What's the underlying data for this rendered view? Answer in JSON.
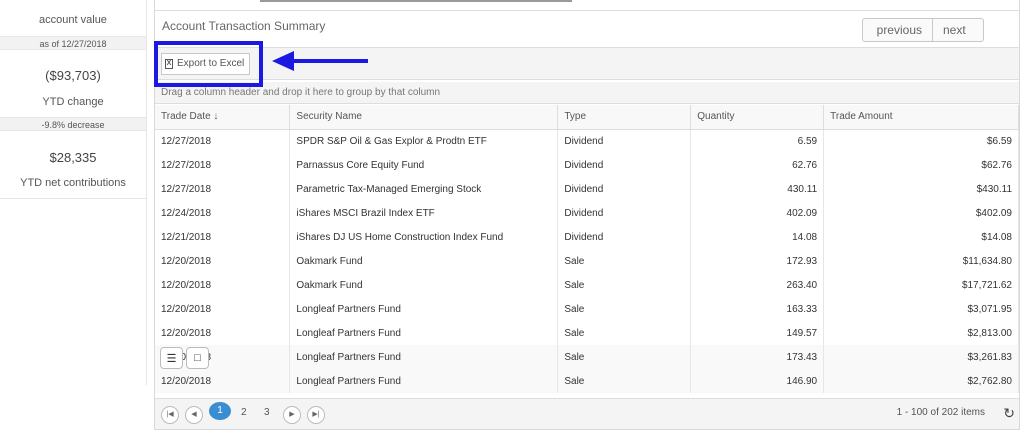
{
  "stats": [
    {
      "value": "",
      "label": "account value",
      "sub": "as of 12/27/2018"
    },
    {
      "value": "($93,703)",
      "label": "YTD change",
      "sub": "-9.8% decrease"
    },
    {
      "value": "$28,335",
      "label": "YTD net contributions",
      "sub": ""
    }
  ],
  "panel": {
    "title": "Account Transaction Summary",
    "previous_label": "previous",
    "next_label": "next",
    "export_label": "Export to Excel",
    "export_icon": "excel-file-icon",
    "group_hint": "Drag a column header and drop it here to group by that column"
  },
  "columns": [
    "Trade Date ↓",
    "Security Name",
    "Type",
    "Quantity",
    "Trade Amount"
  ],
  "rows": [
    [
      "12/27/2018",
      "SPDR S&P Oil & Gas Explor & Prodtn ETF",
      "Dividend",
      "6.59",
      "$6.59"
    ],
    [
      "12/27/2018",
      "Parnassus Core Equity Fund",
      "Dividend",
      "62.76",
      "$62.76"
    ],
    [
      "12/27/2018",
      "Parametric Tax-Managed Emerging Stock",
      "Dividend",
      "430.11",
      "$430.11"
    ],
    [
      "12/24/2018",
      "iShares MSCI Brazil Index ETF",
      "Dividend",
      "402.09",
      "$402.09"
    ],
    [
      "12/21/2018",
      "iShares DJ US Home Construction Index Fund",
      "Dividend",
      "14.08",
      "$14.08"
    ],
    [
      "12/20/2018",
      "Oakmark Fund",
      "Sale",
      "172.93",
      "$11,634.80"
    ],
    [
      "12/20/2018",
      "Oakmark Fund",
      "Sale",
      "263.40",
      "$17,721.62"
    ],
    [
      "12/20/2018",
      "Longleaf Partners Fund",
      "Sale",
      "163.33",
      "$3,071.95"
    ],
    [
      "12/20/2018",
      "Longleaf Partners Fund",
      "Sale",
      "149.57",
      "$2,813.00"
    ],
    [
      "12/20/2018",
      "Longleaf Partners Fund",
      "Sale",
      "173.43",
      "$3,261.83"
    ],
    [
      "12/20/2018",
      "Longleaf Partners Fund",
      "Sale",
      "146.90",
      "$2,762.80"
    ]
  ],
  "pager": {
    "first_icon": "first-page-icon",
    "prev_icon": "prev-page-icon",
    "pages": [
      "1",
      "2",
      "3"
    ],
    "next_icon": "next-page-icon",
    "last_icon": "last-page-icon",
    "items_info": "1 - 100 of 202 items",
    "refresh_icon": "refresh-icon"
  },
  "colors": {
    "highlight": "#1a1ae0",
    "active_page": "#3a8dd0"
  }
}
